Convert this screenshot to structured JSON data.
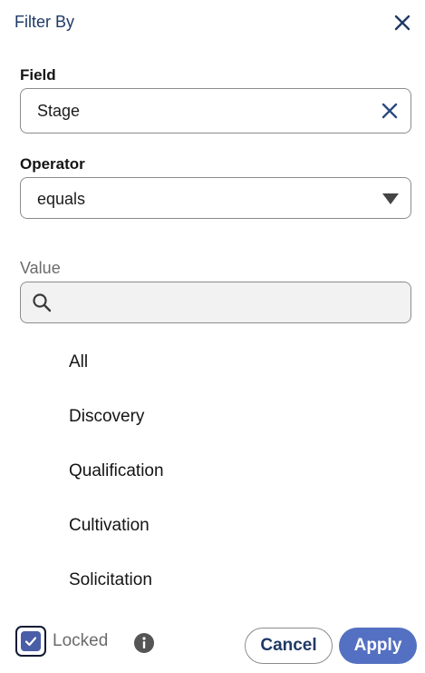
{
  "header": {
    "title": "Filter By"
  },
  "field": {
    "label": "Field",
    "value": "Stage"
  },
  "operator": {
    "label": "Operator",
    "value": "equals"
  },
  "value_section": {
    "label": "Value",
    "search_value": ""
  },
  "options": [
    "All",
    "Discovery",
    "Qualification",
    "Cultivation",
    "Solicitation"
  ],
  "footer": {
    "locked_label": "Locked",
    "locked_checked": true,
    "cancel_label": "Cancel",
    "apply_label": "Apply"
  },
  "colors": {
    "primary": "#5470c2",
    "title": "#1f3a66",
    "checkbox": "#4a5ea8"
  },
  "icons": [
    "close-icon",
    "clear-icon",
    "chevron-down-icon",
    "search-icon",
    "check-icon",
    "info-icon"
  ]
}
